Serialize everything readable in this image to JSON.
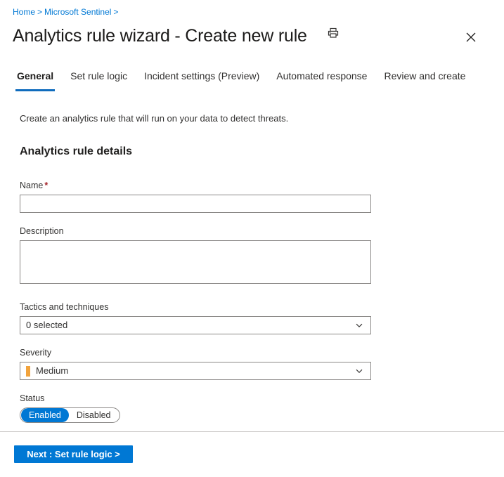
{
  "breadcrumb": {
    "items": [
      "Home",
      "Microsoft Sentinel"
    ],
    "separator": ">",
    "trailing_separator": ">",
    "link_color": "#0078d4"
  },
  "header": {
    "title": "Analytics rule wizard - Create new rule",
    "print_icon": "printer-icon",
    "close_icon": "close-icon"
  },
  "tabs": [
    {
      "label": "General",
      "active": true
    },
    {
      "label": "Set rule logic",
      "active": false
    },
    {
      "label": "Incident settings (Preview)",
      "active": false
    },
    {
      "label": "Automated response",
      "active": false
    },
    {
      "label": "Review and create",
      "active": false
    }
  ],
  "main": {
    "intro": "Create an analytics rule that will run on your data to detect threats.",
    "section_title": "Analytics rule details",
    "fields": {
      "name": {
        "label": "Name",
        "required_marker": "*",
        "value": "",
        "placeholder": ""
      },
      "description": {
        "label": "Description",
        "value": "",
        "placeholder": ""
      },
      "tactics": {
        "label": "Tactics and techniques",
        "value": "0 selected",
        "chevron_icon": "chevron-down-icon"
      },
      "severity": {
        "label": "Severity",
        "value": "Medium",
        "swatch_color": "#f2a33c",
        "chevron_icon": "chevron-down-icon"
      },
      "status": {
        "label": "Status",
        "options": [
          {
            "label": "Enabled",
            "selected": true
          },
          {
            "label": "Disabled",
            "selected": false
          }
        ],
        "selected_color": "#0078d4"
      }
    }
  },
  "footer": {
    "next_label": "Next : Set rule logic >",
    "button_color": "#0078d4"
  }
}
